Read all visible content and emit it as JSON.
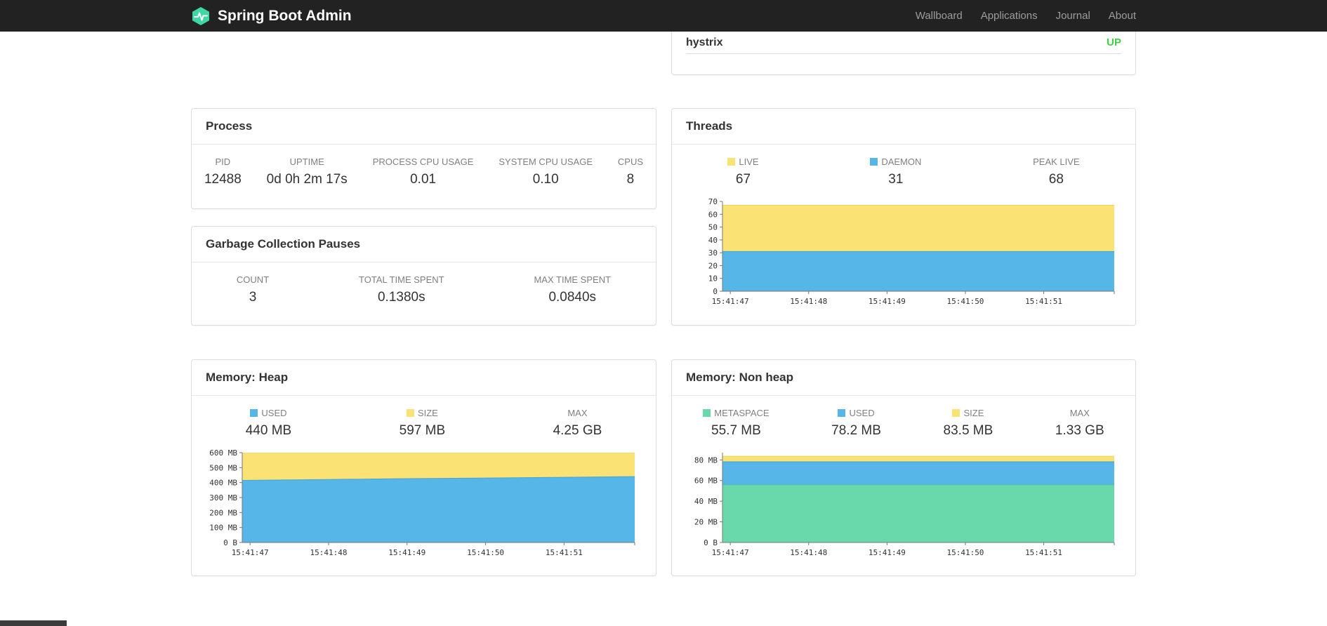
{
  "navbar": {
    "brand": "Spring Boot Admin",
    "items": [
      {
        "label": "Wallboard"
      },
      {
        "label": "Applications"
      },
      {
        "label": "Journal"
      },
      {
        "label": "About"
      }
    ]
  },
  "colors": {
    "accent_teal": "#41d6a5",
    "status_up_green": "#42d142",
    "series_yellow": "#fbe274",
    "series_blue": "#57b6e8",
    "series_green": "#69d9ab"
  },
  "health_card": {
    "row_label": "hystrix",
    "row_status": "UP",
    "status_color": "#42d142"
  },
  "process": {
    "title": "Process",
    "stats": [
      {
        "label": "PID",
        "value": "12488"
      },
      {
        "label": "UPTIME",
        "value": "0d 0h 2m 17s"
      },
      {
        "label": "PROCESS CPU USAGE",
        "value": "0.01"
      },
      {
        "label": "SYSTEM CPU USAGE",
        "value": "0.10"
      },
      {
        "label": "CPUS",
        "value": "8"
      }
    ]
  },
  "gc": {
    "title": "Garbage Collection Pauses",
    "stats": [
      {
        "label": "COUNT",
        "value": "3"
      },
      {
        "label": "TOTAL TIME SPENT",
        "value": "0.1380s"
      },
      {
        "label": "MAX TIME SPENT",
        "value": "0.0840s"
      }
    ]
  },
  "threads": {
    "title": "Threads",
    "stats": [
      {
        "label": "LIVE",
        "value": "67",
        "swatch": "#fbe274"
      },
      {
        "label": "DAEMON",
        "value": "31",
        "swatch": "#57b6e8"
      },
      {
        "label": "PEAK LIVE",
        "value": "68"
      }
    ]
  },
  "memory_heap": {
    "title": "Memory: Heap",
    "stats": [
      {
        "label": "USED",
        "value": "440 MB",
        "swatch": "#57b6e8"
      },
      {
        "label": "SIZE",
        "value": "597 MB",
        "swatch": "#fbe274"
      },
      {
        "label": "MAX",
        "value": "4.25 GB"
      }
    ]
  },
  "memory_nonheap": {
    "title": "Memory: Non heap",
    "stats": [
      {
        "label": "METASPACE",
        "value": "55.7 MB",
        "swatch": "#69d9ab"
      },
      {
        "label": "USED",
        "value": "78.2 MB",
        "swatch": "#57b6e8"
      },
      {
        "label": "SIZE",
        "value": "83.5 MB",
        "swatch": "#fbe274"
      },
      {
        "label": "MAX",
        "value": "1.33 GB"
      }
    ]
  },
  "chart_data": [
    {
      "name": "threads-chart",
      "title": "Threads",
      "type": "area",
      "x_ticks": [
        "15:41:47",
        "15:41:48",
        "15:41:49",
        "15:41:50",
        "15:41:51"
      ],
      "x_tick_fracs": [
        0.02,
        0.22,
        0.42,
        0.62,
        0.82
      ],
      "ylim": [
        0,
        70
      ],
      "y_ticks": [
        {
          "v": 0,
          "label": "0"
        },
        {
          "v": 10,
          "label": "10"
        },
        {
          "v": 20,
          "label": "20"
        },
        {
          "v": 30,
          "label": "30"
        },
        {
          "v": 40,
          "label": "40"
        },
        {
          "v": 50,
          "label": "50"
        },
        {
          "v": 60,
          "label": "60"
        },
        {
          "v": 70,
          "label": "70"
        }
      ],
      "series": [
        {
          "name": "LIVE",
          "color": "#fbe274",
          "line": "#eed65a",
          "values": [
            67,
            67,
            67,
            67,
            67,
            67
          ]
        },
        {
          "name": "DAEMON",
          "color": "#57b6e8",
          "line": "#3ea4da",
          "values": [
            31,
            31,
            31,
            31,
            31,
            31
          ]
        }
      ]
    },
    {
      "name": "memory-heap-chart",
      "title": "Memory: Heap",
      "type": "area",
      "x_ticks": [
        "15:41:47",
        "15:41:48",
        "15:41:49",
        "15:41:50",
        "15:41:51"
      ],
      "x_tick_fracs": [
        0.02,
        0.22,
        0.42,
        0.62,
        0.82
      ],
      "ylim": [
        0,
        600
      ],
      "y_ticks": [
        {
          "v": 0,
          "label": "0 B"
        },
        {
          "v": 100,
          "label": "100 MB"
        },
        {
          "v": 200,
          "label": "200 MB"
        },
        {
          "v": 300,
          "label": "300 MB"
        },
        {
          "v": 400,
          "label": "400 MB"
        },
        {
          "v": 500,
          "label": "500 MB"
        },
        {
          "v": 600,
          "label": "600 MB"
        }
      ],
      "series": [
        {
          "name": "SIZE",
          "color": "#fbe274",
          "line": "#eed65a",
          "values": [
            597,
            597,
            597,
            597,
            597,
            597
          ]
        },
        {
          "name": "USED",
          "color": "#57b6e8",
          "line": "#3ea4da",
          "values": [
            415,
            420,
            426,
            430,
            435,
            440
          ]
        }
      ]
    },
    {
      "name": "memory-nonheap-chart",
      "title": "Memory: Non heap",
      "type": "area",
      "x_ticks": [
        "15:41:47",
        "15:41:48",
        "15:41:49",
        "15:41:50",
        "15:41:51"
      ],
      "x_tick_fracs": [
        0.02,
        0.22,
        0.42,
        0.62,
        0.82
      ],
      "ylim": [
        0,
        87
      ],
      "y_ticks": [
        {
          "v": 0,
          "label": "0 B"
        },
        {
          "v": 20,
          "label": "20 MB"
        },
        {
          "v": 40,
          "label": "40 MB"
        },
        {
          "v": 60,
          "label": "60 MB"
        },
        {
          "v": 80,
          "label": "80 MB"
        }
      ],
      "series": [
        {
          "name": "SIZE",
          "color": "#fbe274",
          "line": "#eed65a",
          "values": [
            83.5,
            83.5,
            83.5,
            83.5,
            83.5,
            83.5
          ]
        },
        {
          "name": "USED",
          "color": "#57b6e8",
          "line": "#3ea4da",
          "values": [
            78.2,
            78.2,
            78.2,
            78.2,
            78.2,
            78.2
          ]
        },
        {
          "name": "METASPACE",
          "color": "#69d9ab",
          "line": "#4ecb97",
          "values": [
            55.7,
            55.7,
            55.7,
            55.7,
            55.7,
            55.7
          ]
        }
      ]
    }
  ]
}
